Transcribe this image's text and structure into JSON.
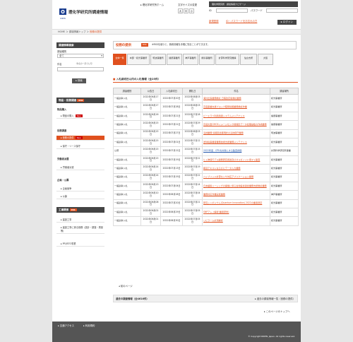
{
  "header": {
    "site_name": "理化学研究所調達情報",
    "org_abbr": "RIKEN",
    "links": [
      "理化学研究所ホーム",
      "文字サイズの変更"
    ],
    "font_sizes": [
      "大",
      "中",
      "小"
    ],
    "login_area_title": "理化学研究所　調達情報ナビゲージ",
    "id_label": "ID",
    "password_label": "パスワード",
    "register_link": "新規登録",
    "forgot_link": "ID・パスワードをお忘れの方",
    "login_label": "ログイン"
  },
  "breadcrumb": [
    "HOME",
    "調達情報トップ",
    "役務の提供"
  ],
  "sidebar": {
    "search_title": "調達情報検索",
    "search_type_label": "調達種別",
    "search_type_value": "全て",
    "keyword_label": "件名",
    "keyword_hint": "（件名の一部でも可）",
    "search_button": "検索",
    "goods_title": "物品・役務調達",
    "goods_rss": "RSS",
    "goods_heading": "物品購入",
    "goods_items": [
      "物品の購入"
    ],
    "goods_new": "New",
    "service_heading": "役務調達",
    "service_items": [
      "役務の提供",
      "保守・リース保守"
    ],
    "service_new": "New",
    "labor_heading": "労働者派遣",
    "labor_items": [
      "労働者派遣"
    ],
    "ads_heading": "企画・公募",
    "ads_items": [
      "企画競争",
      "公募"
    ],
    "works_title": "工事関係",
    "works_rss": "RSS",
    "works_items": [
      "建設工事",
      "建設工事に係る役務（設計・調査・測量等）"
    ],
    "pdf_link": "PFI/BTO事業"
  },
  "main": {
    "title": "役務の提供",
    "rss_label": "RSS",
    "rss_note": "※RSSを使うと、新着情報を手軽に知ることができます。",
    "tabs": [
      "全体一覧",
      "本部・和光事業所",
      "筑波事業所",
      "播磨事業所",
      "神戸事業所",
      "横浜事業所",
      "計算科学研究機構",
      "仙台支所",
      "大阪"
    ],
    "section_title": "入札締切日以内の入札情報（全25件）",
    "columns": [
      "調達種別",
      "公告日",
      "入札締切日",
      "開札日",
      "件名",
      "調達場所"
    ],
    "rows": [
      [
        "一般競争入札",
        "2022年06月17日",
        "2022年07月20日",
        "2022年08月03日",
        "海外出張業務委託 日程改定版委託業務",
        "和光事業所"
      ],
      [
        "一般競争入札",
        "2022年06月17日",
        "2022年07月28日",
        "2022年08月03日",
        "高度産業支援ブロック臨時情報業務委託作業",
        "和光事業所"
      ],
      [
        "一般競争入札",
        "2022年06月16日",
        "2022年07月21日",
        "2022年07月28日",
        "ピーエラベ利用用者システムメンテナンス",
        "播磨事業所"
      ],
      [
        "一般競争入札",
        "2022年06月15日",
        "2022年07月21日",
        "2022年07月29日",
        "高速大型CMOSイメージセンサ用撮影データ処理基板の作成業務",
        "播磨事業所"
      ],
      [
        "一般競争入札",
        "2022年06月15日",
        "2022年07月27日",
        "2022年08月03日",
        "清掃業務 情報環境等現状の清掃保守業務",
        "筑波事業所"
      ],
      [
        "一般競争入札",
        "2022年06月15日",
        "2022年07月01日",
        "2022年07月12日",
        "送球電事業者業務技術支援業務メンテナンス",
        "和光事業所"
      ],
      [
        "公募",
        "2022年06月15日",
        "2022年07月12日",
        "2022年07月15日",
        "2022年度　CPUを対象とする監査評価",
        "計算科学研究所事業"
      ],
      [
        "一般競争入札",
        "2022年06月15日",
        "2022年07月19日",
        "2022年07月22日",
        "ヒト肺病モデル開発研究用途及びオルガノイド用マト監査",
        "和光事業所"
      ],
      [
        "一般競争入札",
        "2022年06月14日",
        "2022年07月13日",
        "2022年07月19日",
        "報道テキストならびにデータ入力業務",
        "和光事業所"
      ],
      [
        "一般競争入札",
        "2022年06月14日",
        "2022年07月19日",
        "2022年07月22日",
        "ハイブリッド計算センサ対応アプリケーション開発",
        "和光事業所"
      ],
      [
        "一般競争入札",
        "2022年06月13日",
        "2022年07月04日",
        "2022年07月14日",
        "日本語版ミーシングの開催に係る会場設営運営業務支援委託業務",
        "和光事業所"
      ],
      [
        "一般競争入札",
        "2022年06月10日",
        "2022年06月28日",
        "2022年07月04日",
        "業務対応作業実施業務",
        "神戸事業所"
      ],
      [
        "一般競争入札",
        "2022年06月08日",
        "2022年07月20日",
        "2022年07月21日",
        "研究シンポジウム(Quantum Innovation) 2022の業者選定",
        "和光事業所"
      ],
      [
        "一般競争入札",
        "2022年06月02日",
        "2022年06月29日",
        "2022年07月05日",
        "SNPアレイ解析(業者研修)",
        "和光事業所"
      ],
      [
        "一般競争入札",
        "2022年06月01日",
        "2022年06月30日",
        "2022年07月05日",
        "リビラーム計測解析",
        "和光事業所"
      ]
    ],
    "prev_page": "前のページ",
    "past_title": "過去の調達情報（全4616件）",
    "past_link": "過去の調達情報一覧（役務の提供）",
    "back_to_top": "このページのトップへ"
  },
  "footer": {
    "links": [
      "交通アクセス",
      "利用規約"
    ],
    "copyright": "© Copyright RIKEN, Japan. All rights reserved."
  }
}
